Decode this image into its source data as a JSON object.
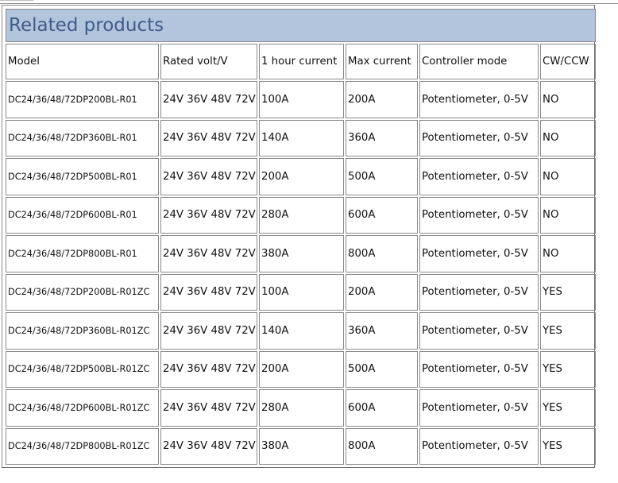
{
  "title": "Related products",
  "columns": [
    "Model",
    "Rated volt/V",
    "1 hour current",
    "Max current",
    "Controller mode",
    "CW/CCW"
  ],
  "rows": [
    [
      "DC24/36/48/72DP200BL-R01",
      "24V 36V 48V 72V",
      "100A",
      "200A",
      "Potentiometer,  0-5V",
      "NO"
    ],
    [
      "DC24/36/48/72DP360BL-R01",
      "24V 36V 48V 72V",
      "140A",
      "360A",
      "Potentiometer, 0-5V",
      "NO"
    ],
    [
      "DC24/36/48/72DP500BL-R01",
      "24V 36V 48V 72V",
      "200A",
      "500A",
      "Potentiometer, 0-5V",
      "NO"
    ],
    [
      "DC24/36/48/72DP600BL-R01",
      "24V 36V 48V 72V",
      "280A",
      "600A",
      "Potentiometer, 0-5V",
      "NO"
    ],
    [
      "DC24/36/48/72DP800BL-R01",
      "24V 36V 48V 72V",
      "380A",
      "800A",
      "Potentiometer, 0-5V",
      "NO"
    ],
    [
      "DC24/36/48/72DP200BL-R01ZC",
      "24V 36V 48V 72V",
      "100A",
      "200A",
      "Potentiometer, 0-5V",
      "YES"
    ],
    [
      "DC24/36/48/72DP360BL-R01ZC",
      "24V 36V 48V 72V",
      "140A",
      "360A",
      "Potentiometer, 0-5V",
      "YES"
    ],
    [
      "DC24/36/48/72DP500BL-R01ZC",
      "24V 36V 48V 72V",
      "200A",
      "500A",
      "Potentiometer, 0-5V",
      "YES"
    ],
    [
      "DC24/36/48/72DP600BL-R01ZC",
      "24V 36V 48V 72V",
      "280A",
      "600A",
      "Potentiometer, 0-5V",
      "YES"
    ],
    [
      "DC24/36/48/72DP800BL-R01ZC",
      "24V 36V 48V 72V",
      "380A",
      "800A",
      "Potentiometer, 0-5V",
      "YES"
    ]
  ],
  "colors": {
    "title_bg": "#b3c4dd",
    "title_text": "#3f5c88",
    "border": "#8a8a8a"
  }
}
